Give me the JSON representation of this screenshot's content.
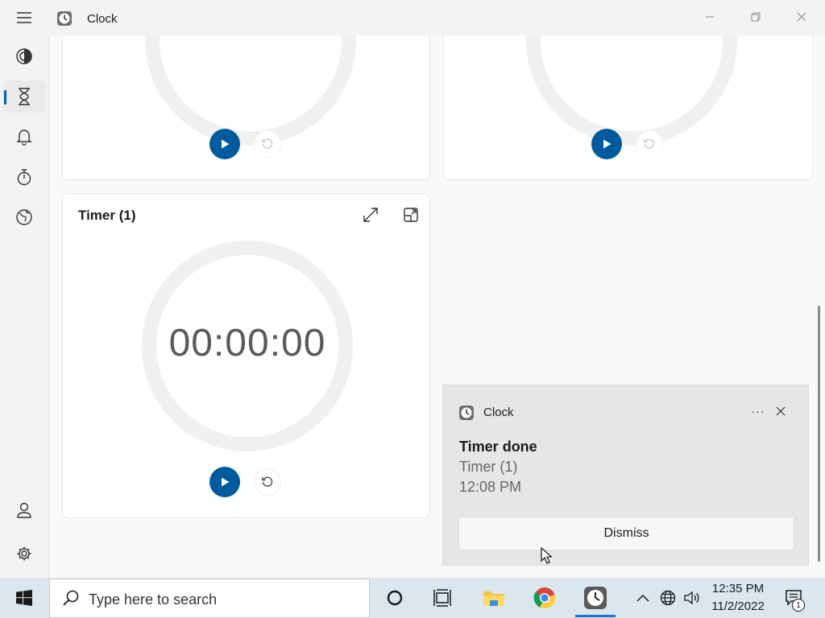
{
  "window": {
    "title": "Clock"
  },
  "timers": {
    "card3_title": "Timer (1)",
    "card3_time": "00:00:00"
  },
  "toast": {
    "app_name": "Clock",
    "more_label": "···",
    "heading": "Timer done",
    "line1": "Timer (1)",
    "line2": "12:08 PM",
    "dismiss_label": "Dismiss"
  },
  "taskbar": {
    "search_placeholder": "Type here to search",
    "time": "12:35 PM",
    "date": "11/2/2022",
    "notification_count": "1"
  },
  "colors": {
    "accent": "#005a9e",
    "nav_indicator": "#005fb8",
    "taskbar_bg": "#dce6ee"
  },
  "icons": {
    "nav": [
      "focus-sessions-icon",
      "timer-hourglass-icon",
      "alarm-bell-icon",
      "stopwatch-icon",
      "world-clock-icon",
      "account-icon",
      "settings-gear-icon"
    ],
    "card": [
      "expand-icon",
      "keep-on-top-icon",
      "play-icon",
      "reset-icon"
    ],
    "taskbar": [
      "windows-start-icon",
      "search-icon",
      "cortana-icon",
      "task-view-icon",
      "file-explorer-icon",
      "chrome-icon",
      "clock-app-icon",
      "show-hidden-icons-chevron",
      "network-globe-icon",
      "volume-icon",
      "action-center-icon"
    ]
  }
}
